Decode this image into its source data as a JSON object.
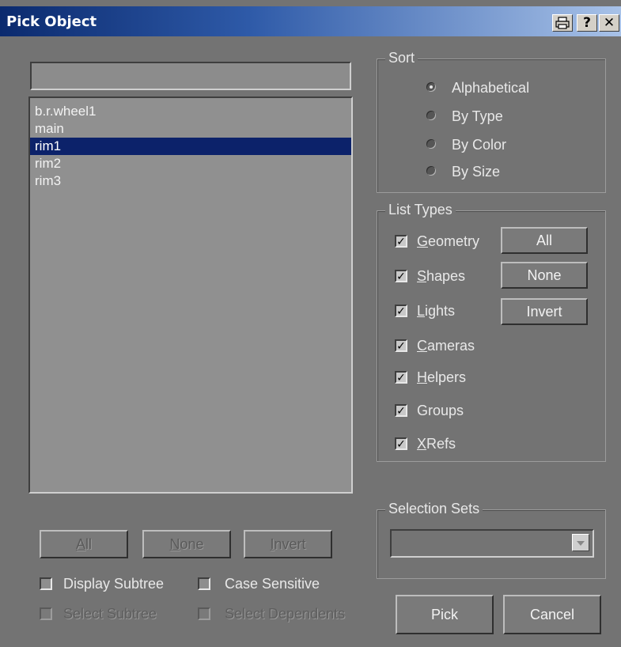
{
  "window": {
    "title": "Pick Object"
  },
  "titlebar_buttons": {
    "print": "🖨",
    "help": "?",
    "close": "✕"
  },
  "search": {
    "value": "",
    "placeholder": ""
  },
  "objects": [
    "b.r.wheel1",
    "main",
    "rim1",
    "rim2",
    "rim3"
  ],
  "selected_object": "rim1",
  "list_buttons": {
    "all": "All",
    "none": "None",
    "invert": "Invert"
  },
  "options": {
    "display_subtree": "Display Subtree",
    "case_sensitive": "Case Sensitive",
    "select_subtree": "Select Subtree",
    "select_dependents": "Select Dependents"
  },
  "sort": {
    "label": "Sort",
    "alphabetical": "Alphabetical",
    "by_type": "By Type",
    "by_color": "By Color",
    "by_size": "By Size",
    "selected": "Alphabetical"
  },
  "list_types": {
    "label": "List Types",
    "geometry": "Geometry",
    "shapes": "Shapes",
    "lights": "Lights",
    "cameras": "Cameras",
    "helpers": "Helpers",
    "groups": "Groups",
    "xrefs": "XRefs",
    "btn_all": "All",
    "btn_none": "None",
    "btn_invert": "Invert"
  },
  "selection_sets": {
    "label": "Selection Sets",
    "value": ""
  },
  "actions": {
    "pick": "Pick",
    "cancel": "Cancel"
  },
  "colors": {
    "titlebar_start": "#0b2a6e",
    "selection": "#0c226a",
    "panel": "#737373"
  }
}
